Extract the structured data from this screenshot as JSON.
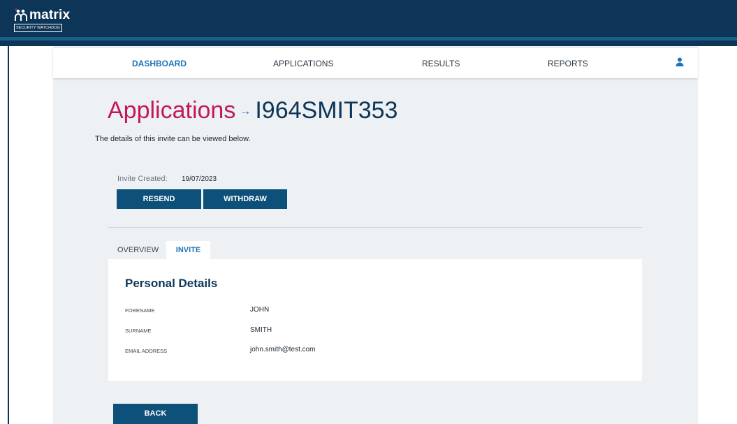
{
  "brand": {
    "name": "matrix",
    "tagline": "SECURITY WATCHDOG",
    "colors": {
      "header": "#0d3557",
      "accent": "#c2185b",
      "primary": "#0d5079",
      "link": "#1e73b8"
    }
  },
  "nav": {
    "items": [
      {
        "label": "DASHBOARD",
        "active": true
      },
      {
        "label": "APPLICATIONS",
        "active": false
      },
      {
        "label": "RESULTS",
        "active": false
      },
      {
        "label": "REPORTS",
        "active": false
      }
    ],
    "user_icon": "user-icon"
  },
  "page": {
    "title": "Applications",
    "arrow": "→",
    "record_id": "I964SMIT353",
    "intro": "The details of this invite can be viewed below.",
    "invite_created_label": "Invite Created:",
    "invite_created_date": "19/07/2023"
  },
  "actions": {
    "resend": "RESEND",
    "withdraw": "WITHDRAW",
    "back": "BACK"
  },
  "tabs": [
    {
      "label": "OVERVIEW",
      "active": false
    },
    {
      "label": "INVITE",
      "active": true
    }
  ],
  "personal_details": {
    "title": "Personal Details",
    "fields": [
      {
        "label": "FORENAME",
        "value": "JOHN"
      },
      {
        "label": "SURNAME",
        "value": "SMITH"
      },
      {
        "label": "EMAIL ADDRESS",
        "value": "john.smith@test.com"
      }
    ]
  }
}
